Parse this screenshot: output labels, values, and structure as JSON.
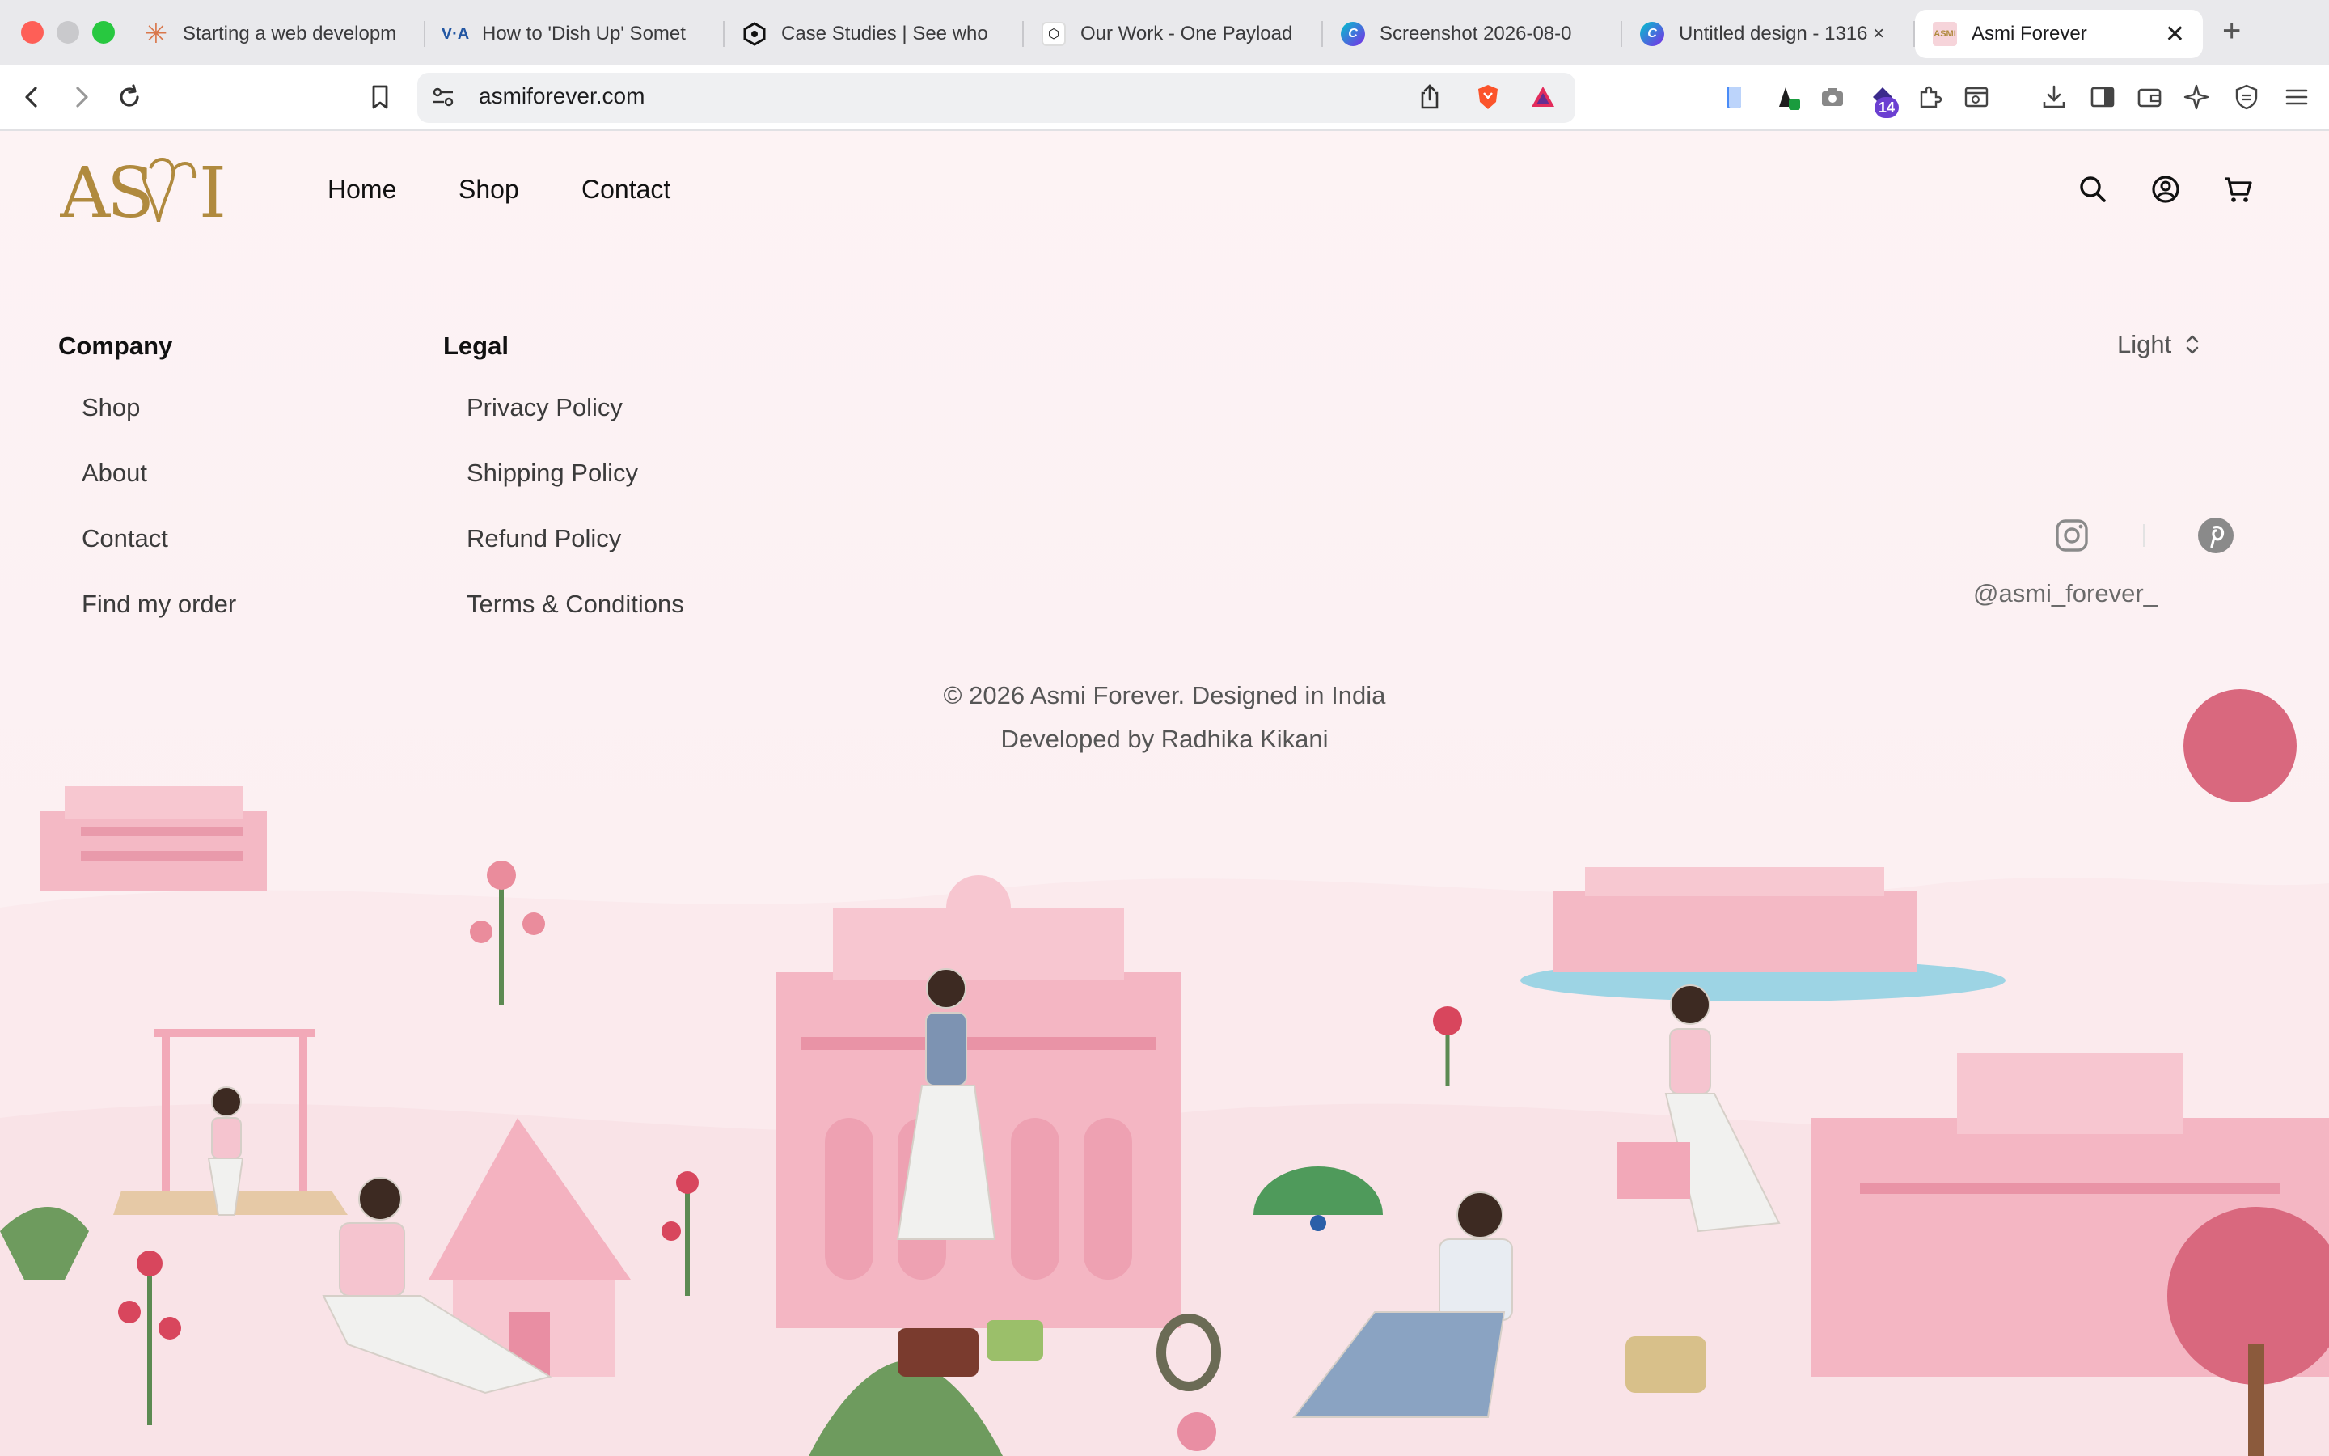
{
  "browser": {
    "tabs": [
      {
        "label": "Starting a web developm",
        "favicon": "claude-icon",
        "color": "#d9774b"
      },
      {
        "label": "How to 'Dish Up' Somet",
        "favicon": "voa-icon",
        "color": "#2357a3"
      },
      {
        "label": "Case Studies | See who",
        "favicon": "hexagon-logo-icon",
        "color": "#111111"
      },
      {
        "label": "Our Work - One Payload",
        "favicon": "payload-icon",
        "color": "#111111"
      },
      {
        "label": "Screenshot 2026-08-0",
        "favicon": "canva-icon",
        "color": "#7d2ae8"
      },
      {
        "label": "Untitled design - 1316 ×",
        "favicon": "canva-icon",
        "color": "#7d2ae8"
      },
      {
        "label": "Asmi Forever",
        "favicon": "asmi-icon",
        "color": "#f3c8cf",
        "active": true
      }
    ],
    "url": "asmiforever.com",
    "extensions_badge": "14"
  },
  "site": {
    "logo_text": "ASMI",
    "nav": [
      "Home",
      "Shop",
      "Contact"
    ],
    "footer": {
      "company_heading": "Company",
      "company_links": [
        "Shop",
        "About",
        "Contact",
        "Find my order"
      ],
      "legal_heading": "Legal",
      "legal_links": [
        "Privacy Policy",
        "Shipping Policy",
        "Refund Policy",
        "Terms & Conditions"
      ],
      "theme_label": "Light",
      "social_handle": "@asmi_forever_",
      "copyright": "© 2026 Asmi Forever. Designed in India",
      "developer": "Developed by Radhika Kikani"
    }
  },
  "colors": {
    "accent_gold": "#b08a3e",
    "pink": "#f2b3c0",
    "page_bg": "#fdf3f4"
  }
}
